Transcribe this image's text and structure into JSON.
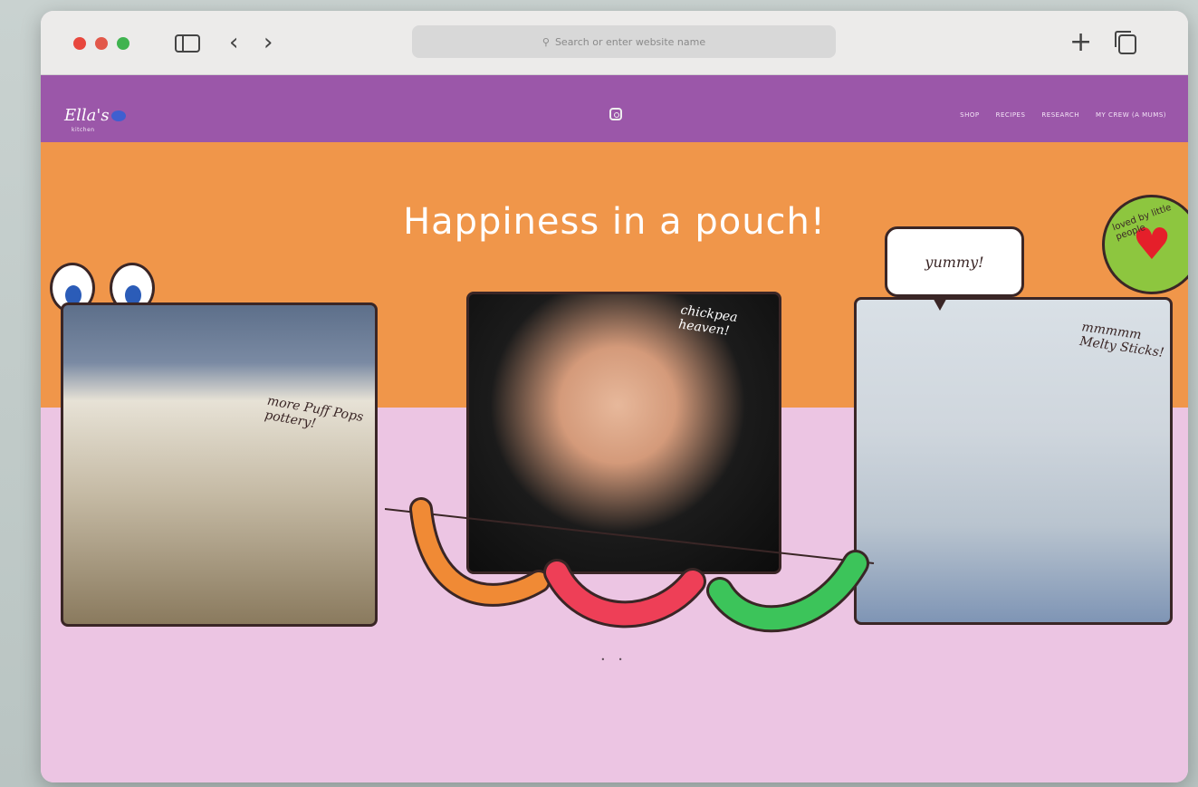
{
  "browser": {
    "address_placeholder": "Search or enter website name",
    "icons": [
      "sidebar-icon",
      "back-icon",
      "forward-icon",
      "search-icon",
      "new-tab-icon",
      "tabs-overview-icon"
    ]
  },
  "site": {
    "logo": "Ella's",
    "logo_sub": "kitchen",
    "nav": [
      "shop",
      "recipes",
      "research",
      "my CREW (a mums)"
    ],
    "instagram_icon": "instagram-icon"
  },
  "hero": {
    "headline": "Happiness in a pouch!",
    "captions": {
      "photo1": "more Puff Pops pottery!",
      "photo2": "chickpea heaven!",
      "photo3": "mmmmm Melty Sticks!"
    },
    "bubble": "yummy!",
    "badge_text": "loved by little people",
    "pager": "• •"
  },
  "colors": {
    "nav_purple": "#9b57a9",
    "hero_orange": "#f0964a",
    "hero_pink": "#ecc5e3"
  }
}
